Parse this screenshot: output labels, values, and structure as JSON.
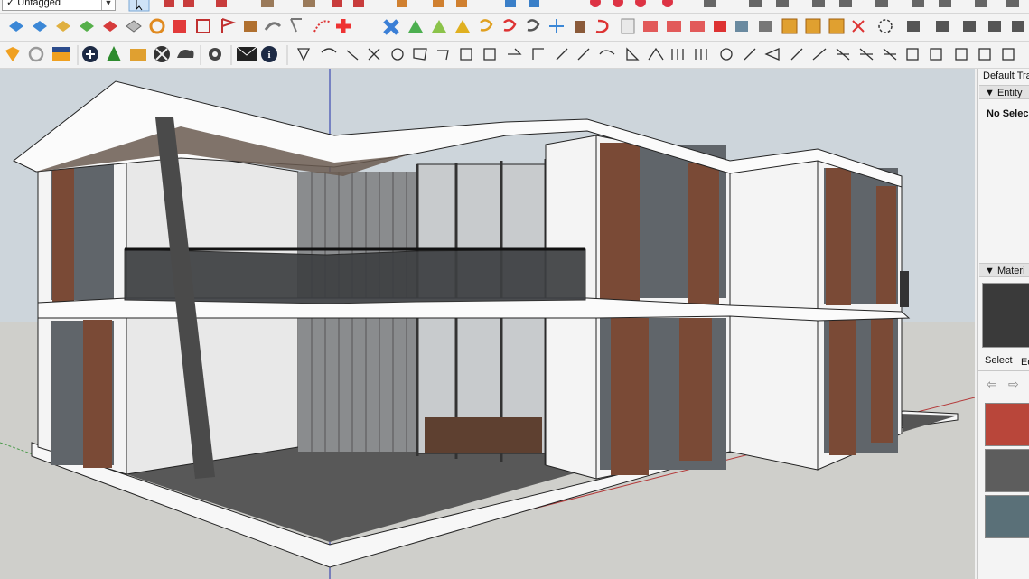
{
  "toolbar": {
    "tag_selector": {
      "value": "Untagged",
      "check": "✓"
    }
  },
  "tray": {
    "title": "Default Tra",
    "entity_info": {
      "header": "Entity",
      "status": "No Selec"
    },
    "materials": {
      "header": "Materi",
      "tabs": [
        "Select",
        "Ed"
      ],
      "swatch_colors": [
        "#3a3a3a",
        "#b9463a",
        "#5d5d5d",
        "#5a7078"
      ]
    }
  },
  "viewport": {
    "colors": {
      "sky": "#cfd7dd",
      "ground": "#cfcfcb",
      "wall": "#f4f4f4",
      "shutter": "#7a4a36",
      "glass": "#5e6266",
      "slab": "#4a4a4a"
    }
  }
}
